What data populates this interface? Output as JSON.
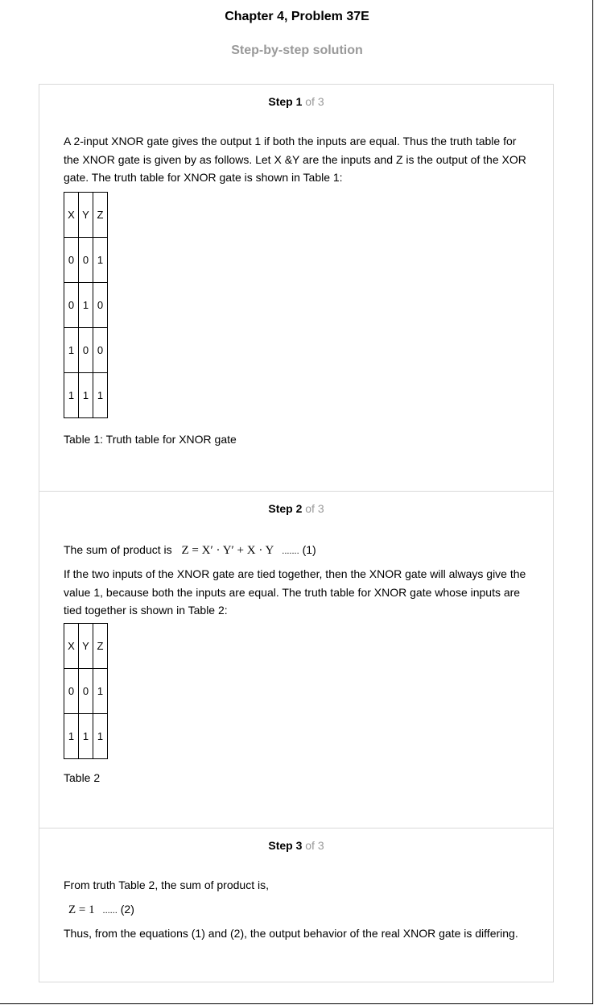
{
  "header": {
    "title": "Chapter 4, Problem 37E",
    "subtitle": "Step-by-step solution"
  },
  "steps": [
    {
      "label": "Step 1",
      "of": "of 3",
      "text": "A 2-input XNOR gate gives the output 1 if both the inputs are equal. Thus the truth table for the XNOR gate is given by as follows. Let X &Y are the inputs and Z is the output of the XOR gate. The truth table for XNOR gate is shown in Table 1:",
      "table": {
        "headers": [
          "X",
          "Y",
          "Z"
        ],
        "rows": [
          [
            "0",
            "0",
            "1"
          ],
          [
            "0",
            "1",
            "0"
          ],
          [
            "1",
            "0",
            "0"
          ],
          [
            "1",
            "1",
            "1"
          ]
        ]
      },
      "caption": "Table 1: Truth table for XNOR gate"
    },
    {
      "label": "Step 2",
      "of": "of 3",
      "sop_intro": "The sum of product is",
      "equation": "Z = X′ · Y′ + X · Y",
      "dots": ".......",
      "eq_number": "(1)",
      "text": "If the two inputs of the XNOR gate are tied together, then the XNOR gate will always give the value 1, because both the inputs are equal. The truth table for XNOR gate whose inputs are tied together is shown in Table 2:",
      "table": {
        "headers": [
          "X",
          "Y",
          "Z"
        ],
        "rows": [
          [
            "0",
            "0",
            "1"
          ],
          [
            "1",
            "1",
            "1"
          ]
        ]
      },
      "caption": "Table 2"
    },
    {
      "label": "Step 3",
      "of": "of 3",
      "text": "From truth Table 2, the sum of product is,",
      "equation": "Z = 1",
      "dots": "......",
      "eq_number": "(2)",
      "conclusion": "Thus, from the equations (1) and (2), the output behavior of the real XNOR gate is differing."
    }
  ]
}
